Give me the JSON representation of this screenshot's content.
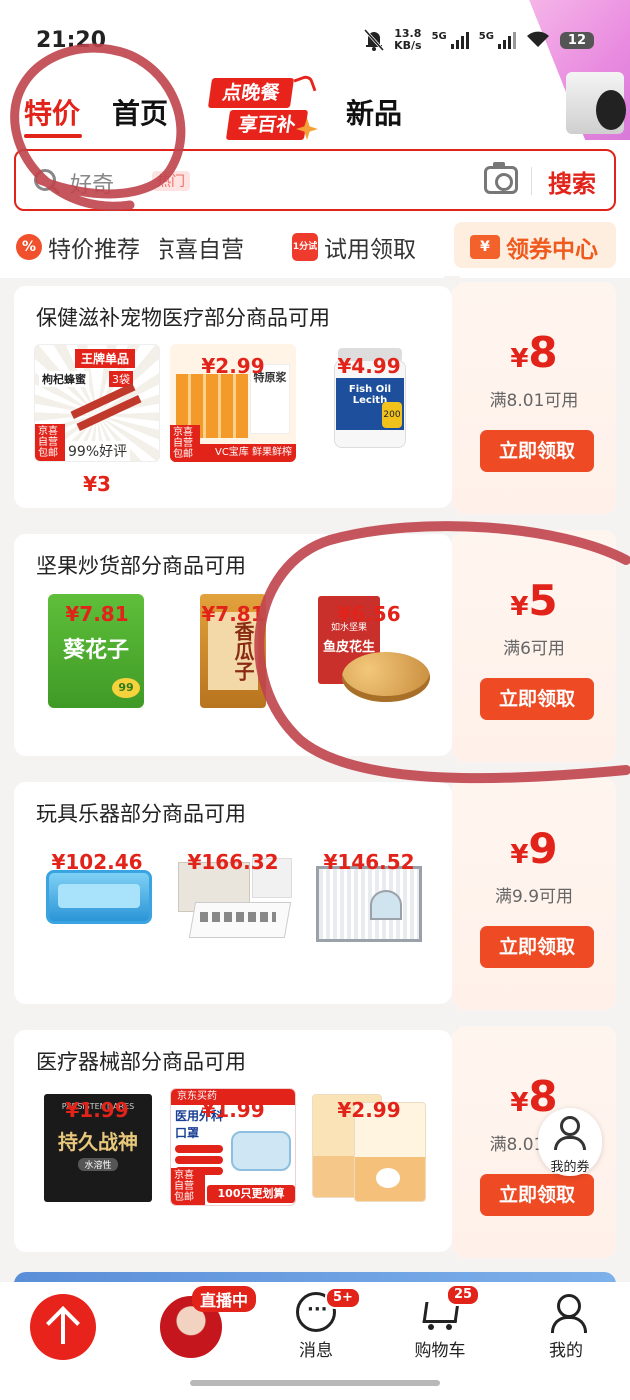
{
  "status_bar": {
    "time": "21:20",
    "net_speed": "13.8",
    "net_unit": "KB/s",
    "sig1": "5G",
    "sig2": "5G",
    "battery": "12"
  },
  "nav_tabs": [
    {
      "label": "特价",
      "active": true
    },
    {
      "label": "首页",
      "active": false
    },
    {
      "label": "新品",
      "active": false
    }
  ],
  "promo": {
    "line1": "点晚餐",
    "line2": "享百补"
  },
  "search": {
    "placeholder_text": "好奇",
    "placeholder_tag": "热门",
    "button": "搜索",
    "icon": "search-icon"
  },
  "shortcuts": [
    {
      "label": "特价推荐",
      "icon_text": "%"
    },
    {
      "label": "京喜自营"
    },
    {
      "label": "试用领取",
      "icon_text": "1分试"
    },
    {
      "label": "领券中心",
      "icon_text": "¥"
    }
  ],
  "coupons": [
    {
      "title": "保健滋补宠物医疗部分商品可用",
      "yen": "¥",
      "amount": "8",
      "condition": "满8.01可用",
      "button": "立即领取",
      "products": [
        {
          "price": "¥3",
          "img_text": "王牌单品",
          "img_sub": "枸杞蜂蜜",
          "img_badge": "3袋",
          "rating": "99%好评",
          "mini": "京喜自营 包邮"
        },
        {
          "price": "¥2.99",
          "img_text": "特原浆",
          "img_sub": "VC宝库 鲜果鲜榨",
          "mini": "京喜自营 包邮"
        },
        {
          "price": "¥4.99",
          "img_text": "Fish Oil Lecith",
          "img_sub": "200"
        }
      ]
    },
    {
      "title": "坚果炒货部分商品可用",
      "yen": "¥",
      "amount": "5",
      "condition": "满6可用",
      "button": "立即领取",
      "products": [
        {
          "price": "¥7.81",
          "img_text": "葵花子",
          "img_sub": "99"
        },
        {
          "price": "¥7.81",
          "img_text": "香瓜子"
        },
        {
          "price": "¥6.56",
          "img_text": "鱼皮花生",
          "img_sub": "如水坚果"
        }
      ]
    },
    {
      "title": "玩具乐器部分商品可用",
      "yen": "¥",
      "amount": "9",
      "condition": "满9.9可用",
      "button": "立即领取",
      "products": [
        {
          "price": "¥102.46"
        },
        {
          "price": "¥166.32"
        },
        {
          "price": "¥146.52"
        }
      ]
    },
    {
      "title": "医疗器械部分商品可用",
      "yen": "¥",
      "amount": "8",
      "condition": "满8.01可用",
      "button": "立即领取",
      "products": [
        {
          "price": "¥1.99",
          "img_text": "持久战神",
          "img_top": "PERSISTENT ARES",
          "img_sub": "水溶性"
        },
        {
          "price": "¥1.99",
          "img_text": "医用外科口罩",
          "img_top": "京东买药",
          "img_sub": "100只更划算",
          "mini": "京喜自营 包邮"
        },
        {
          "price": "¥2.99"
        }
      ]
    }
  ],
  "floating": {
    "my_coupon": "我的券"
  },
  "bottom_nav": {
    "live_tag": "直播中",
    "items": [
      {
        "label": "消息",
        "badge": "5+"
      },
      {
        "label": "购物车",
        "badge": "25"
      },
      {
        "label": "我的"
      }
    ]
  },
  "colors": {
    "accent": "#e2231a",
    "button": "#ee4a24",
    "annotation": "#c0444d"
  }
}
